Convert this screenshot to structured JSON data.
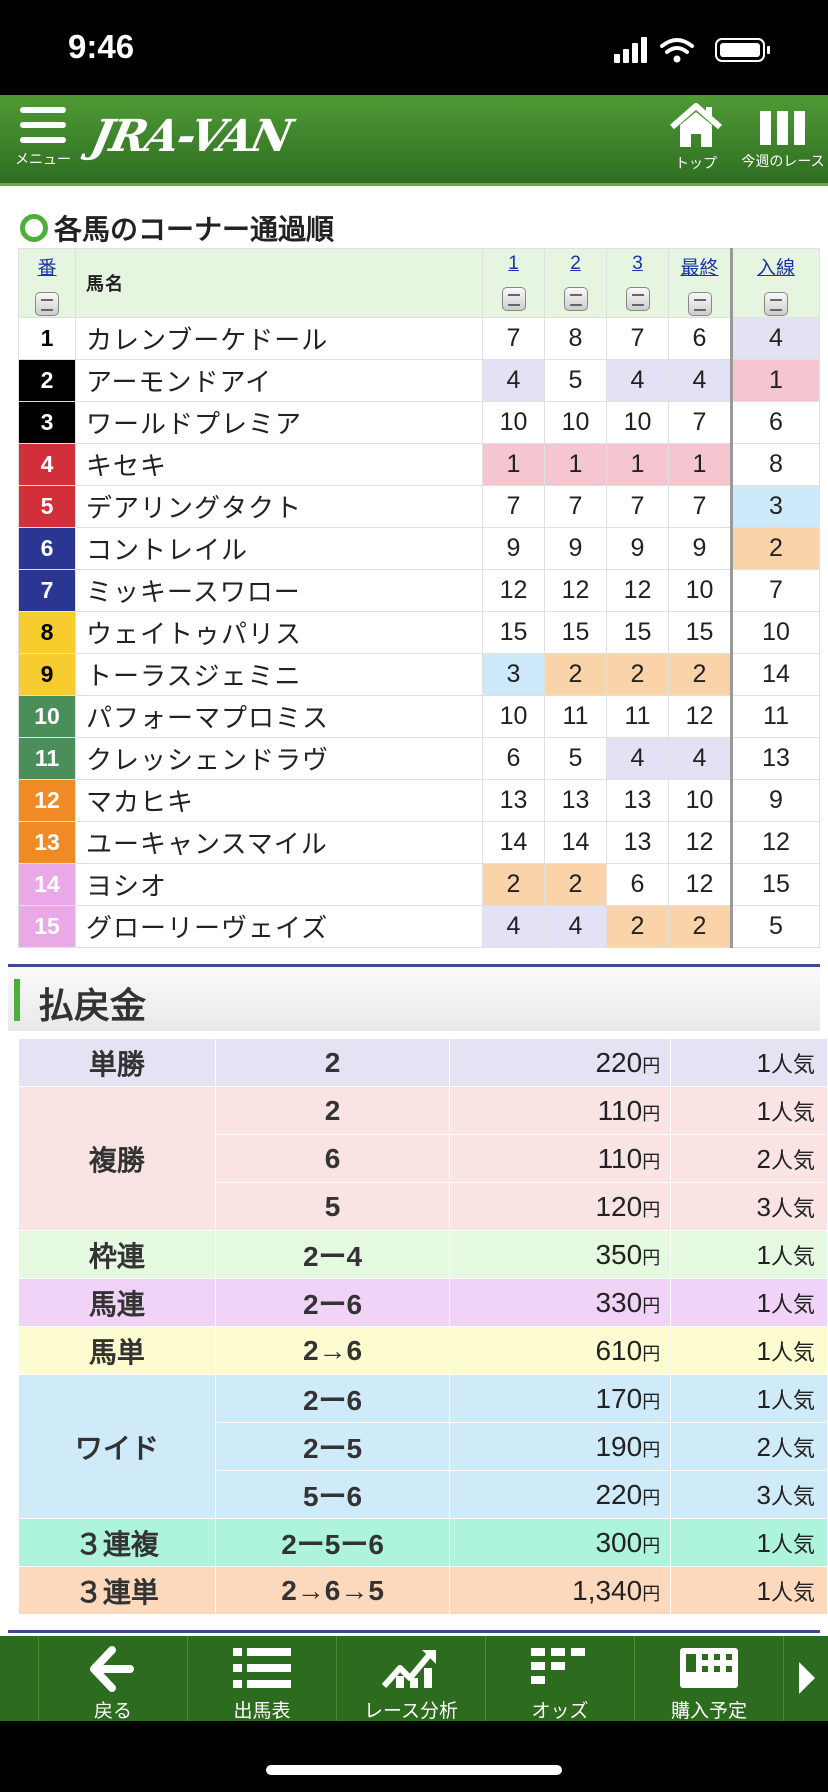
{
  "status": {
    "time": "9:46"
  },
  "header": {
    "menu_label": "メニュー",
    "logo": "JRA-VAN",
    "top_label": "トップ",
    "races_label": "今週のレース"
  },
  "corner": {
    "title": "各馬のコーナー通過順",
    "headers": {
      "num": "番",
      "name": "馬名",
      "c1": "1",
      "c2": "2",
      "c3": "3",
      "final": "最終",
      "finish": "入線"
    },
    "rows": [
      {
        "num": "1",
        "name": "カレンブーケドール",
        "c1": "7",
        "c2": "8",
        "c3": "7",
        "final": "6",
        "finish": "4"
      },
      {
        "num": "2",
        "name": "アーモンドアイ",
        "c1": "4",
        "c2": "5",
        "c3": "4",
        "final": "4",
        "finish": "1"
      },
      {
        "num": "3",
        "name": "ワールドプレミア",
        "c1": "10",
        "c2": "10",
        "c3": "10",
        "final": "7",
        "finish": "6"
      },
      {
        "num": "4",
        "name": "キセキ",
        "c1": "1",
        "c2": "1",
        "c3": "1",
        "final": "1",
        "finish": "8"
      },
      {
        "num": "5",
        "name": "デアリングタクト",
        "c1": "7",
        "c2": "7",
        "c3": "7",
        "final": "7",
        "finish": "3"
      },
      {
        "num": "6",
        "name": "コントレイル",
        "c1": "9",
        "c2": "9",
        "c3": "9",
        "final": "9",
        "finish": "2"
      },
      {
        "num": "7",
        "name": "ミッキースワロー",
        "c1": "12",
        "c2": "12",
        "c3": "12",
        "final": "10",
        "finish": "7"
      },
      {
        "num": "8",
        "name": "ウェイトゥパリス",
        "c1": "15",
        "c2": "15",
        "c3": "15",
        "final": "15",
        "finish": "10"
      },
      {
        "num": "9",
        "name": "トーラスジェミニ",
        "c1": "3",
        "c2": "2",
        "c3": "2",
        "final": "2",
        "finish": "14"
      },
      {
        "num": "10",
        "name": "パフォーマプロミス",
        "c1": "10",
        "c2": "11",
        "c3": "11",
        "final": "12",
        "finish": "11"
      },
      {
        "num": "11",
        "name": "クレッシェンドラヴ",
        "c1": "6",
        "c2": "5",
        "c3": "4",
        "final": "4",
        "finish": "13"
      },
      {
        "num": "12",
        "name": "マカヒキ",
        "c1": "13",
        "c2": "13",
        "c3": "13",
        "final": "10",
        "finish": "9"
      },
      {
        "num": "13",
        "name": "ユーキャンスマイル",
        "c1": "14",
        "c2": "14",
        "c3": "13",
        "final": "12",
        "finish": "12"
      },
      {
        "num": "14",
        "name": "ヨシオ",
        "c1": "2",
        "c2": "2",
        "c3": "6",
        "final": "12",
        "finish": "15"
      },
      {
        "num": "15",
        "name": "グローリーヴェイズ",
        "c1": "4",
        "c2": "4",
        "c3": "2",
        "final": "2",
        "finish": "5"
      }
    ],
    "colors": {
      "rank1": "#f5c6cf",
      "rank2": "#fbd3a8",
      "rank3": "#cde8f8",
      "rank4": "#e2e2f4",
      "gate": [
        "#ffffff",
        "#000000",
        "#d12f3a",
        "#2b3592",
        "#f7cc2e",
        "#4a8f5a",
        "#f08a24",
        "#e8a9e6"
      ]
    }
  },
  "payout": {
    "title": "払戻金",
    "unit_yen": "円",
    "unit_pop": "人気",
    "rows": [
      {
        "kind": "単勝",
        "combo": "2",
        "amount": "220",
        "pop": "1",
        "bg": "#e3e3f3"
      },
      {
        "kind": "複勝",
        "combo": "2",
        "amount": "110",
        "pop": "1",
        "bg": "#fae3e3"
      },
      {
        "kind": "",
        "combo": "6",
        "amount": "110",
        "pop": "2",
        "bg": "#fae3e3"
      },
      {
        "kind": "",
        "combo": "5",
        "amount": "120",
        "pop": "3",
        "bg": "#fae3e3"
      },
      {
        "kind": "枠連",
        "combo": "2ー4",
        "amount": "350",
        "pop": "1",
        "bg": "#e5f8e0"
      },
      {
        "kind": "馬連",
        "combo": "2ー6",
        "amount": "330",
        "pop": "1",
        "bg": "#f0d3f7"
      },
      {
        "kind": "馬単",
        "combo": "2→6",
        "amount": "610",
        "pop": "1",
        "bg": "#fdfbd0"
      },
      {
        "kind": "ワイド",
        "combo": "2ー6",
        "amount": "170",
        "pop": "1",
        "bg": "#cfeaf8"
      },
      {
        "kind": "",
        "combo": "2ー5",
        "amount": "190",
        "pop": "2",
        "bg": "#cfeaf8"
      },
      {
        "kind": "",
        "combo": "5ー6",
        "amount": "220",
        "pop": "3",
        "bg": "#cfeaf8"
      },
      {
        "kind": "３連複",
        "combo": "2ー5ー6",
        "amount": "300",
        "pop": "1",
        "bg": "#aef4dc"
      },
      {
        "kind": "３連単",
        "combo": "2→6→5",
        "amount": "1,340",
        "pop": "1",
        "bg": "#fcd9bd"
      }
    ]
  },
  "bottom_nav": {
    "items": [
      "戻る",
      "出馬表",
      "レース分析",
      "オッズ",
      "購入予定"
    ]
  }
}
